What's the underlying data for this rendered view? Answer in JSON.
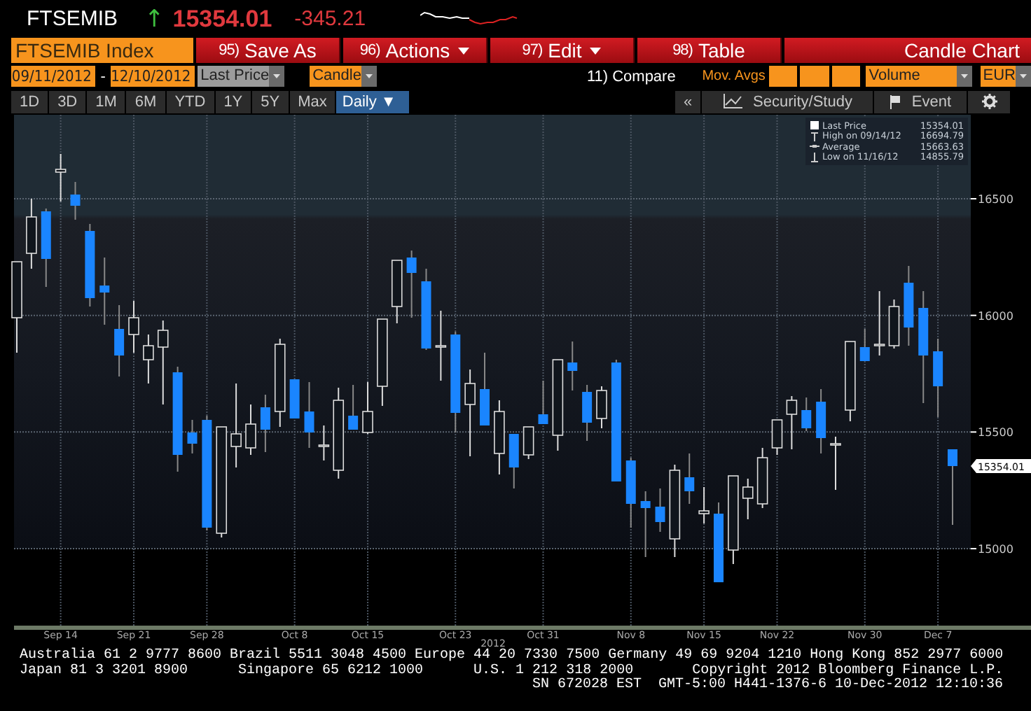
{
  "header": {
    "ticker": "FTSEMIB",
    "arrow": "↑",
    "last_price": "15354.01",
    "change": "-345.21"
  },
  "toolbar": {
    "security": "FTSEMIB Index",
    "title": "Candle Chart",
    "buttons": [
      {
        "number": "95)",
        "label": "Save As",
        "dropdown": false
      },
      {
        "number": "96)",
        "label": "Actions",
        "dropdown": true
      },
      {
        "number": "97)",
        "label": "Edit",
        "dropdown": true
      },
      {
        "number": "98)",
        "label": "Table",
        "dropdown": false
      }
    ]
  },
  "settings": {
    "start_date": "09/11/2012",
    "separator": "-",
    "end_date": "12/10/2012",
    "price_field": "Last Price",
    "chart_type": "Candle",
    "compare": "11) Compare",
    "mov_avgs_label": "Mov. Avgs",
    "lower_panel": "Volume",
    "currency": "EUR"
  },
  "ranges": [
    "1D",
    "3D",
    "1M",
    "6M",
    "YTD",
    "1Y",
    "5Y",
    "Max"
  ],
  "frequency": "Daily ▼",
  "right_tools": {
    "collapse": "«",
    "study": "Security/Study",
    "event": "Event"
  },
  "chart": {
    "legend": [
      {
        "kind": "last",
        "label": "Last Price",
        "value": "15354.01"
      },
      {
        "kind": "high",
        "label": "High on 09/14/12",
        "value": "16694.79"
      },
      {
        "kind": "average",
        "label": "Average",
        "value": "15663.63"
      },
      {
        "kind": "low",
        "label": "Low on 11/16/12",
        "value": "14855.79"
      }
    ],
    "last_tag": "15354.01",
    "year": "2012",
    "chart_data": {
      "type": "candlestick",
      "categories": [
        null,
        null,
        null,
        "Sep 14",
        null,
        null,
        null,
        null,
        "Sep 21",
        null,
        null,
        null,
        null,
        "Sep 28",
        null,
        null,
        null,
        null,
        null,
        "Oct 8",
        null,
        null,
        null,
        null,
        "Oct 15",
        null,
        null,
        null,
        null,
        null,
        "Oct 23",
        null,
        null,
        null,
        null,
        null,
        "Oct 31",
        null,
        null,
        null,
        null,
        null,
        "Nov 8",
        null,
        null,
        null,
        null,
        "Nov 15",
        null,
        null,
        null,
        null,
        "Nov 22",
        null,
        null,
        null,
        null,
        null,
        "Nov 30",
        null,
        null,
        null,
        null,
        "Dec 7",
        null
      ],
      "ohlc": [
        [
          15990,
          16230,
          15840,
          16230
        ],
        [
          16266,
          16500,
          16200,
          16422
        ],
        [
          16446,
          16458,
          16122,
          16242
        ],
        [
          16614,
          16692,
          16488,
          16626
        ],
        [
          16518,
          16572,
          16410,
          16470
        ],
        [
          16362,
          16392,
          16038,
          16074
        ],
        [
          16128,
          16248,
          15960,
          16098
        ],
        [
          15942,
          16044,
          15738,
          15828
        ],
        [
          15918,
          16062,
          15840,
          15990
        ],
        [
          15810,
          15918,
          15708,
          15870
        ],
        [
          15864,
          15978,
          15618,
          15936
        ],
        [
          15756,
          15780,
          15330,
          15402
        ],
        [
          15498,
          15552,
          15408,
          15450
        ],
        [
          15552,
          15570,
          15078,
          15090
        ],
        [
          15066,
          15522,
          15048,
          15522
        ],
        [
          15438,
          15708,
          15348,
          15492
        ],
        [
          15432,
          15618,
          15402,
          15534
        ],
        [
          15606,
          15660,
          15414,
          15510
        ],
        [
          15588,
          15900,
          15522,
          15876
        ],
        [
          15726,
          15726,
          15558,
          15558
        ],
        [
          15588,
          15714,
          15432,
          15498
        ],
        [
          15438,
          15528,
          15378,
          15444
        ],
        [
          15336,
          15690,
          15300,
          15636
        ],
        [
          15570,
          15702,
          15510,
          15510
        ],
        [
          15498,
          15714,
          15492,
          15588
        ],
        [
          15696,
          15984,
          15612,
          15984
        ],
        [
          16038,
          16236,
          15966,
          16236
        ],
        [
          16248,
          16278,
          15990,
          16182
        ],
        [
          16146,
          16200,
          15852,
          15858
        ],
        [
          15864,
          16020,
          15720,
          15870
        ],
        [
          15918,
          15930,
          15498,
          15582
        ],
        [
          15618,
          15768,
          15396,
          15708
        ],
        [
          15684,
          15840,
          15528,
          15528
        ],
        [
          15408,
          15636,
          15318,
          15588
        ],
        [
          15492,
          15492,
          15258,
          15348
        ],
        [
          15402,
          15522,
          15384,
          15522
        ],
        [
          15576,
          15720,
          15534,
          15534
        ],
        [
          15486,
          15810,
          15420,
          15810
        ],
        [
          15798,
          15888,
          15678,
          15762
        ],
        [
          15672,
          15702,
          15462,
          15540
        ],
        [
          15558,
          15696,
          15516,
          15678
        ],
        [
          15798,
          15810,
          15288,
          15288
        ],
        [
          15378,
          15390,
          15090,
          15192
        ],
        [
          15204,
          15246,
          14964,
          15174
        ],
        [
          15180,
          15258,
          15072,
          15114
        ],
        [
          15042,
          15360,
          14964,
          15336
        ],
        [
          15306,
          15408,
          15192,
          15246
        ],
        [
          15150,
          15264,
          15108,
          15162
        ],
        [
          15150,
          15198,
          14856,
          14856
        ],
        [
          14994,
          15312,
          14934,
          15312
        ],
        [
          15216,
          15300,
          15126,
          15264
        ],
        [
          15192,
          15432,
          15174,
          15390
        ],
        [
          15432,
          15552,
          15402,
          15552
        ],
        [
          15576,
          15654,
          15426,
          15636
        ],
        [
          15594,
          15648,
          15504,
          15516
        ],
        [
          15630,
          15684,
          15408,
          15474
        ],
        [
          15444,
          15480,
          15252,
          15450
        ],
        [
          15594,
          15888,
          15546,
          15888
        ],
        [
          15864,
          15942,
          15804,
          15804
        ],
        [
          15870,
          16104,
          15828,
          15876
        ],
        [
          15870,
          16068,
          15858,
          16038
        ],
        [
          16140,
          16212,
          15870,
          15948
        ],
        [
          16032,
          16104,
          15624,
          15828
        ],
        [
          15846,
          15900,
          15564,
          15696
        ],
        [
          15426,
          15426,
          15102,
          15354
        ]
      ],
      "ylim": [
        14670,
        16860
      ],
      "yticks": [
        16500,
        16000,
        15500,
        15000
      ],
      "grid": true
    }
  },
  "footer": {
    "lines": [
      "Australia 61 2 9777 8600 Brazil 5511 3048 4500 Europe 44 20 7330 7500 Germany 49 69 9204 1210 Hong Kong 852 2977 6000",
      "Japan 81 3 3201 8900      Singapore 65 6212 1000      U.S. 1 212 318 2000       Copyright 2012 Bloomberg Finance L.P."
    ],
    "session": "SN 672028 EST  GMT-5:00 H441-1376-6 10-Dec-2012 12:10:36"
  }
}
